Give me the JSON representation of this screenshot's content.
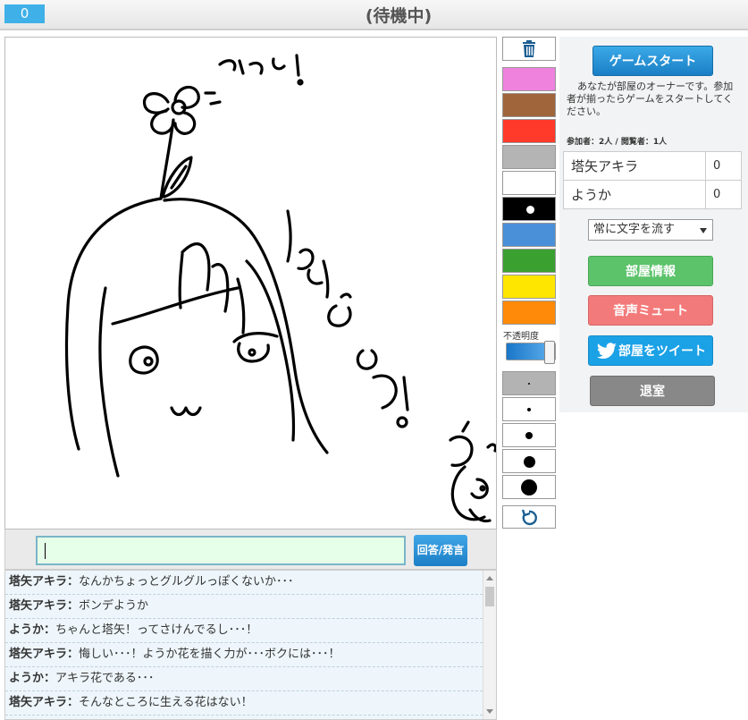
{
  "header": {
    "round": "0",
    "status": "(待機中)"
  },
  "canvas": {
    "doodle_text_top": "～とうぉ！",
    "doodle_text_side": "しんどう！"
  },
  "answer": {
    "value": "",
    "button_label": "回答/発言"
  },
  "chat": [
    {
      "name": "塔矢アキラ",
      "message": "なんかちょっとグルグルっぽくないか･･･"
    },
    {
      "name": "塔矢アキラ",
      "message": "ボンデようか"
    },
    {
      "name": "ようか",
      "message": "ちゃんと塔矢！ってさけんでるし･･･！"
    },
    {
      "name": "塔矢アキラ",
      "message": "悔しい･･･！ようか花を描く力が･･･ボクには･･･！"
    },
    {
      "name": "ようか",
      "message": "アキラ花である･･･"
    },
    {
      "name": "塔矢アキラ",
      "message": "そんなところに生える花はない！"
    }
  ],
  "tools": {
    "colors": [
      "#ee82dd",
      "#a0653a",
      "#ff3a2a",
      "#b4b4b4",
      "#ffffff",
      "#000000",
      "#4a90d9",
      "#3aa030",
      "#ffe600",
      "#ff8a0a"
    ],
    "selected_color": "#000000",
    "opacity_label": "不透明度",
    "opacity": 1.0,
    "pen_sizes": [
      1,
      2,
      3,
      4,
      5
    ],
    "selected_pen_size": 1
  },
  "panel": {
    "start_label": "ゲームスタート",
    "owner_message": "あなたが部屋のオーナーです。参加者が揃ったらゲームをスタートしてください。",
    "participants_label": "参加者：",
    "participants": "2人",
    "viewers_label": "閲覧者：",
    "viewers": "1人",
    "players": [
      {
        "name": "塔矢アキラ",
        "score": "0"
      },
      {
        "name": "ようか",
        "score": "0"
      }
    ],
    "flow_select": "常に文字を流す",
    "info_label": "部屋情報",
    "mute_label": "音声ミュート",
    "tweet_label": "部屋をツイート",
    "leave_label": "退室"
  }
}
